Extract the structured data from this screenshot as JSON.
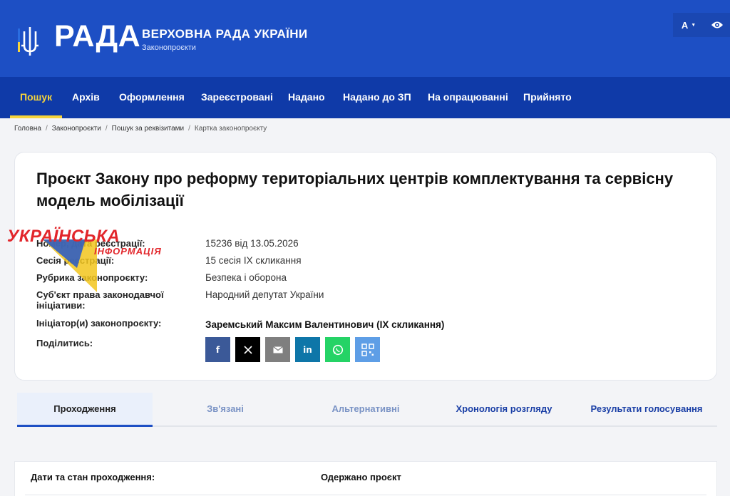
{
  "header": {
    "logo_text": "РАДА",
    "title": "ВЕРХОВНА РАДА УКРАЇНИ",
    "subtitle": "Законопроєкти",
    "font_size_label": "A",
    "brand_color": "#1d4fc4",
    "nav_color": "#0f3aa8",
    "accent_color": "#f6d43b"
  },
  "nav": {
    "items": [
      {
        "label": "Пошук",
        "active": true
      },
      {
        "label": "Архів"
      },
      {
        "label": "Оформлення"
      },
      {
        "label": "Зареєстровані"
      },
      {
        "label": "Надано"
      },
      {
        "label": "Надано до ЗП"
      },
      {
        "label": "На опрацюванні"
      },
      {
        "label": "Прийнято"
      }
    ]
  },
  "breadcrumb": [
    "Головна",
    "Законопроєкти",
    "Пошук за реквізитами",
    "Картка законопроєкту"
  ],
  "bill": {
    "title": "Проєкт Закону про реформу територіальних центрів комплектування та сервісну модель мобілізації",
    "fields": [
      {
        "label": "Номер, дата реєстрації:",
        "value": "15236 від 13.05.2026"
      },
      {
        "label": "Сесія реєстрації:",
        "value": "15 сесія IX скликання"
      },
      {
        "label": "Рубрика законопроєкту:",
        "value": "Безпека і оборона"
      },
      {
        "label": "Суб'єкт права законодавчої ініціативи:",
        "value": "Народний депутат України"
      },
      {
        "label": "Ініціатор(и) законопроєкту:",
        "value": "Заремський Максим Валентинович (IX скликання)"
      },
      {
        "label": "Поділитись:",
        "value": ""
      }
    ],
    "share": [
      {
        "icon": "facebook-icon",
        "glyph": "f",
        "color": "#3b5998"
      },
      {
        "icon": "x-icon",
        "glyph": "𝕏",
        "color": "#000000"
      },
      {
        "icon": "email-icon",
        "glyph": "✉",
        "color": "#7f7f7f"
      },
      {
        "icon": "linkedin-icon",
        "glyph": "in",
        "color": "#0e76a8"
      },
      {
        "icon": "whatsapp-icon",
        "glyph": "✆",
        "color": "#25d366"
      },
      {
        "icon": "qr-code-icon",
        "glyph": "▦",
        "color": "#5e9ee6"
      }
    ]
  },
  "watermark": {
    "line1": "УКРАЇНСЬКА",
    "line2": "ІНФОРМАЦІЯ"
  },
  "tabs": [
    {
      "label": "Проходження",
      "active": true
    },
    {
      "label": "Зв'язані"
    },
    {
      "label": "Альтернативні"
    },
    {
      "label": "Хронологія розгляду"
    },
    {
      "label": "Результати голосування"
    }
  ],
  "panel": {
    "col1": "Дати та стан проходження:",
    "col2": "Одержано проєкт"
  }
}
